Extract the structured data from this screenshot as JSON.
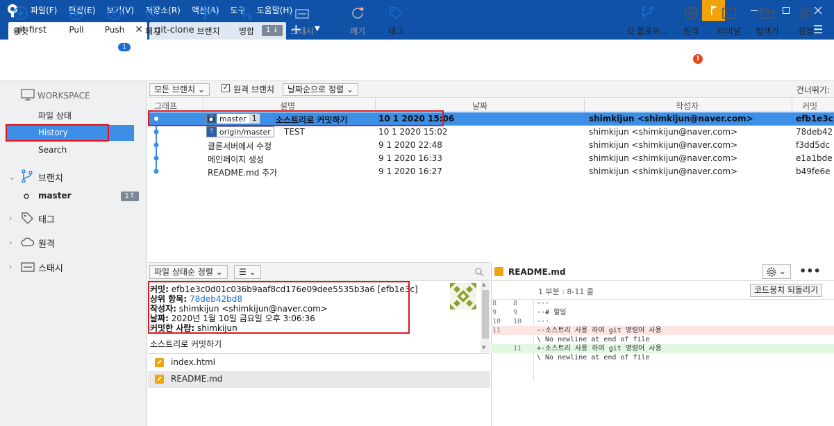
{
  "app": {
    "menu": [
      "파일(F)",
      "편집(E)",
      "보기(V)",
      "저장소(R)",
      "액션(A)",
      "도구",
      "도움말(H)"
    ]
  },
  "tabs": [
    {
      "label": "git-first",
      "active": true
    },
    {
      "label": "git-clone",
      "badge": "1 ↓"
    }
  ],
  "toolbar": {
    "commit": "커밋",
    "pull": "Pull",
    "push": "Push",
    "push_badge": "1",
    "fetch": "패치",
    "branch": "브랜치",
    "merge": "병합",
    "stash": "스태시",
    "discard": "폐기",
    "tag": "태그",
    "git_flow": "깃 플로우...",
    "remote": "원격",
    "terminal": "터미널",
    "explorer": "탐색기",
    "settings": "설정"
  },
  "sidebar": {
    "workspace": "WORKSPACE",
    "file_status": "파일 상태",
    "history": "History",
    "search": "Search",
    "branches": "브랜치",
    "branch_master": "master",
    "branch_master_badge": "1↑",
    "tags": "태그",
    "remotes": "원격",
    "stashes": "스태시"
  },
  "list_toolbar": {
    "all_branches": "모든 브랜치",
    "remote_branches": "원격 브랜치",
    "remote_checked": true,
    "sort": "날짜순으로 정렬",
    "skip": "건너뛰기:"
  },
  "columns": {
    "graph": "그래프",
    "desc": "설명",
    "date": "날짜",
    "author": "작성자",
    "commit": "커밋"
  },
  "commits": [
    {
      "branch": "master",
      "branch_count": "1",
      "desc": "소스트리로 커밋하기",
      "date": "10 1 2020 15:06",
      "author": "shimkijun <shimkijun@naver.com>",
      "hash": "efb1e3c"
    },
    {
      "branch": "origin/master",
      "desc": "TEST",
      "date": "10 1 2020 15:02",
      "author": "shimkijun <shimkijun@naver.com>",
      "hash": "78deb42"
    },
    {
      "desc": "클론서버에서 수정",
      "date": "9 1 2020 22:48",
      "author": "shimkijun <shimkijun@naver.com>",
      "hash": "f3dd5dc"
    },
    {
      "desc": "메인페이지 생성",
      "date": "9 1 2020 16:33",
      "author": "shimkijun <shimkijun@naver.com>",
      "hash": "e1a1bde"
    },
    {
      "desc": "README.md 추가",
      "date": "9 1 2020 16:27",
      "author": "shimkijun <shimkijun@naver.com>",
      "hash": "b49fe6e"
    }
  ],
  "bottom_left": {
    "sort": "파일 상태순 정렬",
    "view": "☰"
  },
  "details": {
    "commit_label": "커밋:",
    "commit_value": "efb1e3c0d01c036b9aaf8cd176e09dee5535b3a6 [efb1e3c]",
    "parent_label": "상위 항목:",
    "parent_value": "78deb42bd8",
    "author_label": "작성자:",
    "author_value": "shimkijun <shimkijun@naver.com>",
    "date_label": "날짜:",
    "date_value": "2020년 1월 10일 금요일 오후 3:06:36",
    "committer_label": "커밋한 사람:",
    "committer_value": "shimkijun",
    "message": "소스트리로 커밋하기"
  },
  "files": [
    "index.html",
    "README.md"
  ],
  "diff": {
    "filename": "README.md",
    "hunk_title": "1 부분 : 8-11 줄",
    "hunk_button": "코드뭉치 되돌리기",
    "lines": [
      {
        "o": "8",
        "n": "8",
        "t": "···",
        "k": "ctx"
      },
      {
        "o": "9",
        "n": "9",
        "t": "··# 할일",
        "k": "ctx"
      },
      {
        "o": "10",
        "n": "10",
        "t": "···",
        "k": "ctx"
      },
      {
        "o": "11",
        "n": "",
        "t": "-·소스트리 사용 하여 git 명령어 사용",
        "k": "del"
      },
      {
        "o": "",
        "n": "",
        "t": "\\ No newline at end of file",
        "k": "del2"
      },
      {
        "o": "",
        "n": "11",
        "t": "+·소스트리 사용 하여 git 명령어 사용",
        "k": "add"
      },
      {
        "o": "",
        "n": "",
        "t": "\\ No newline at end of file",
        "k": "ctx"
      }
    ]
  }
}
